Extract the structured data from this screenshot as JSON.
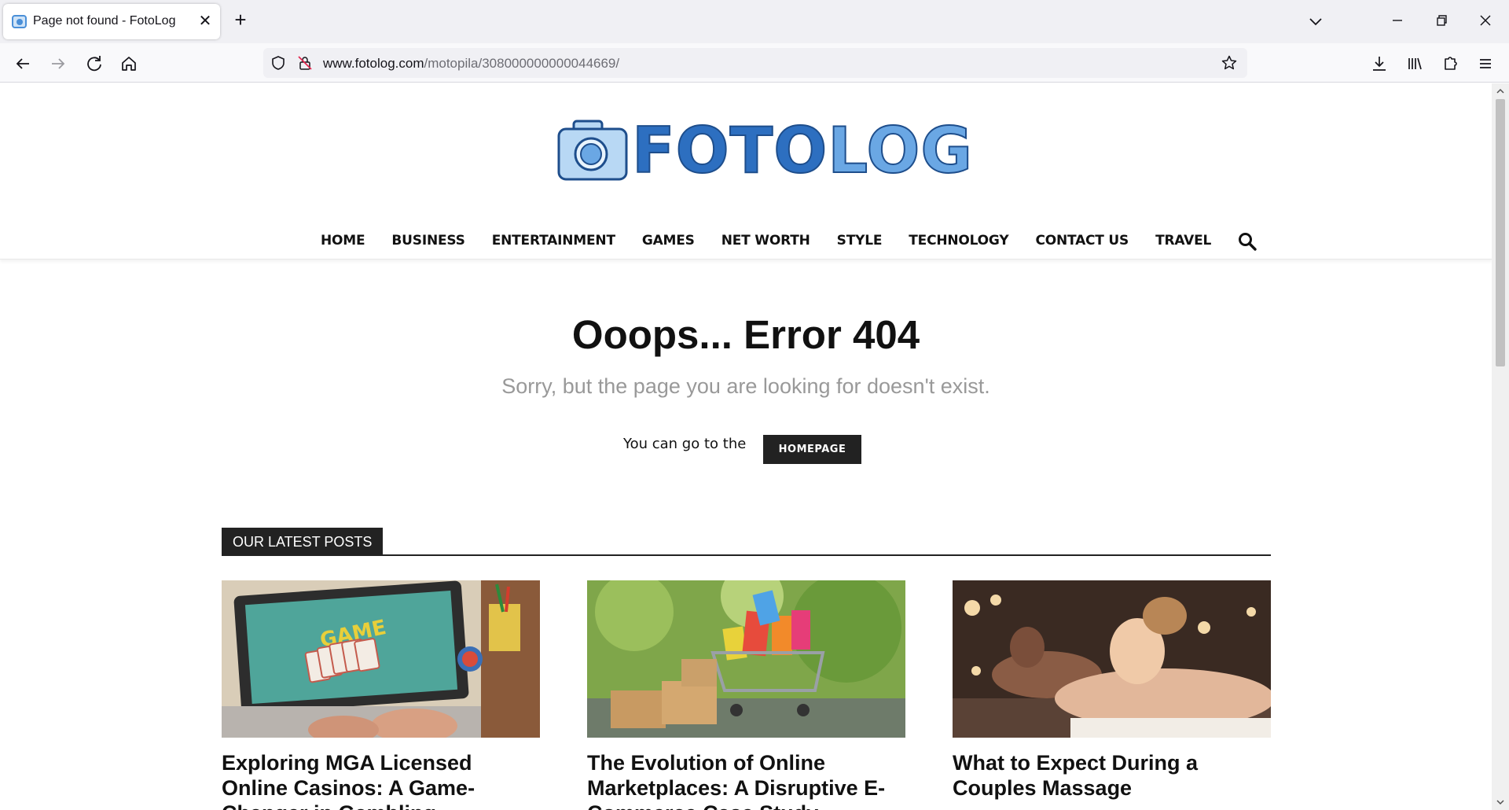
{
  "browser": {
    "tab_title": "Page not found - FotoLog",
    "url_domain": "www.fotolog.com",
    "url_path": "/motopila/308000000000044669/"
  },
  "site": {
    "logo_part1": "FOTO",
    "logo_part2": "LOG",
    "menu": [
      "HOME",
      "BUSINESS",
      "ENTERTAINMENT",
      "GAMES",
      "NET WORTH",
      "STYLE",
      "TECHNOLOGY",
      "CONTACT US",
      "TRAVEL"
    ]
  },
  "error": {
    "title": "Ooops... Error 404",
    "subtitle": "Sorry, but the page you are looking for doesn't exist.",
    "goto_text": "You can go to the",
    "homepage_button": "HOMEPAGE"
  },
  "latest": {
    "heading": "OUR LATEST POSTS",
    "posts": [
      {
        "title": "Exploring MGA Licensed Online Casinos: A Game-Changer in Gambling",
        "image_text": "GAME"
      },
      {
        "title": "The Evolution of Online Marketplaces: A Disruptive E-Commerce Case Study"
      },
      {
        "title": "What to Expect During a Couples Massage"
      }
    ]
  },
  "colors": {
    "brand_blue": "#2d6fc0",
    "brand_light_blue": "#6aa7e4",
    "dark": "#222222"
  }
}
